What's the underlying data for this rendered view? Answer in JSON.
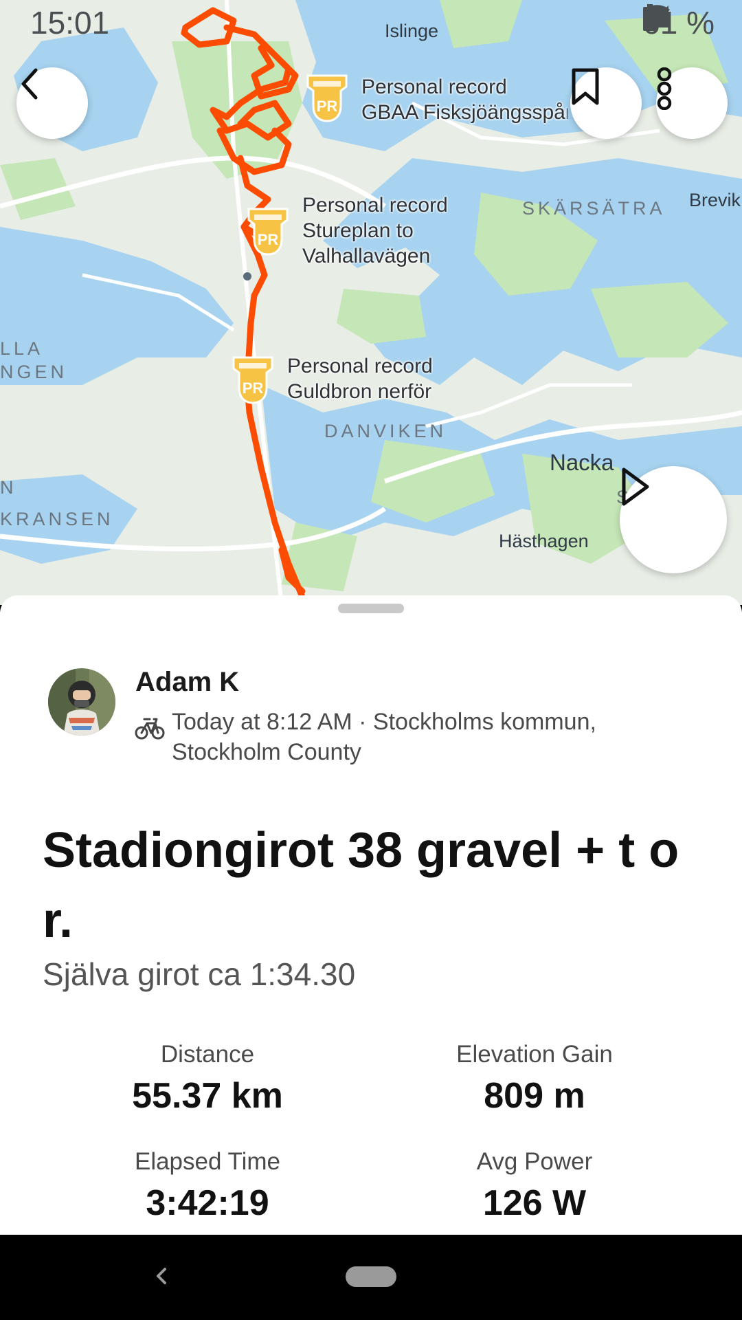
{
  "status_bar": {
    "time": "15:01",
    "battery": "61 %",
    "icons": [
      "wifi-icon",
      "signal-icon",
      "battery-icon"
    ]
  },
  "map": {
    "labels": {
      "islinge": "Islinge",
      "skarsatra": "SKÄRSÄTRA",
      "brevik": "Brevik",
      "lla": "LLA",
      "ngen": "NGEN",
      "n": "N",
      "kransen": "KRANSEN",
      "danviken": "DANVIKEN",
      "nacka": "Nacka",
      "hasthagen": "Hästhagen",
      "s_d": "S  D"
    },
    "personal_records": [
      {
        "line1": "Personal record",
        "line2": "GBAA Fisksjöängsspår",
        "badge": "PR"
      },
      {
        "line1": "Personal record",
        "line2": "Stureplan to",
        "line3": "Valhallavägen",
        "badge": "PR"
      },
      {
        "line1": "Personal record",
        "line2": "Guldbron nerför",
        "badge": "PR"
      }
    ],
    "route_color": "#fc4c02"
  },
  "buttons": {
    "back_icon": "chevron-left-icon",
    "bookmark_icon": "bookmark-icon",
    "more_icon": "more-vertical-icon",
    "play_icon": "play-icon"
  },
  "activity": {
    "athlete_name": "Adam K",
    "sport_icon": "bike-icon",
    "meta_line1": "Today at 8:12 AM · Stockholms kommun,",
    "meta_line2": "Stockholm County",
    "title": "Stadiongirot 38 gravel + t o r.",
    "description": "Själva girot ca 1:34.30"
  },
  "stats": [
    {
      "label": "Distance",
      "value": "55.37 km"
    },
    {
      "label": "Elevation Gain",
      "value": "809 m"
    },
    {
      "label": "Elapsed Time",
      "value": "3:42:19"
    },
    {
      "label": "Avg Power",
      "value": "126 W"
    }
  ]
}
